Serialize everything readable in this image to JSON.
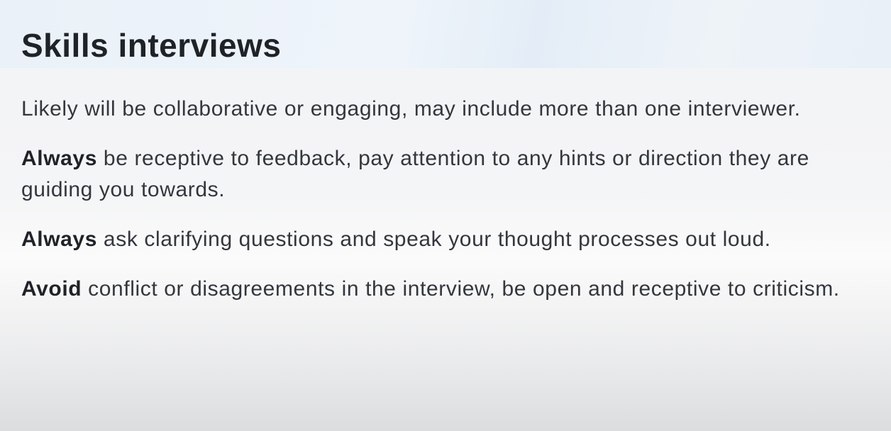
{
  "slide": {
    "title": "Skills interviews",
    "paragraphs": [
      {
        "lead": "",
        "text": "Likely will be collaborative or engaging, may include more than one interviewer."
      },
      {
        "lead": "Always",
        "text": " be receptive to feedback, pay attention to any hints or direction they are guiding you towards."
      },
      {
        "lead": "Always",
        "text": " ask clarifying questions and speak your thought processes out loud."
      },
      {
        "lead": "Avoid",
        "text": " conflict or disagreements in the interview, be open and receptive to criticism."
      }
    ]
  }
}
